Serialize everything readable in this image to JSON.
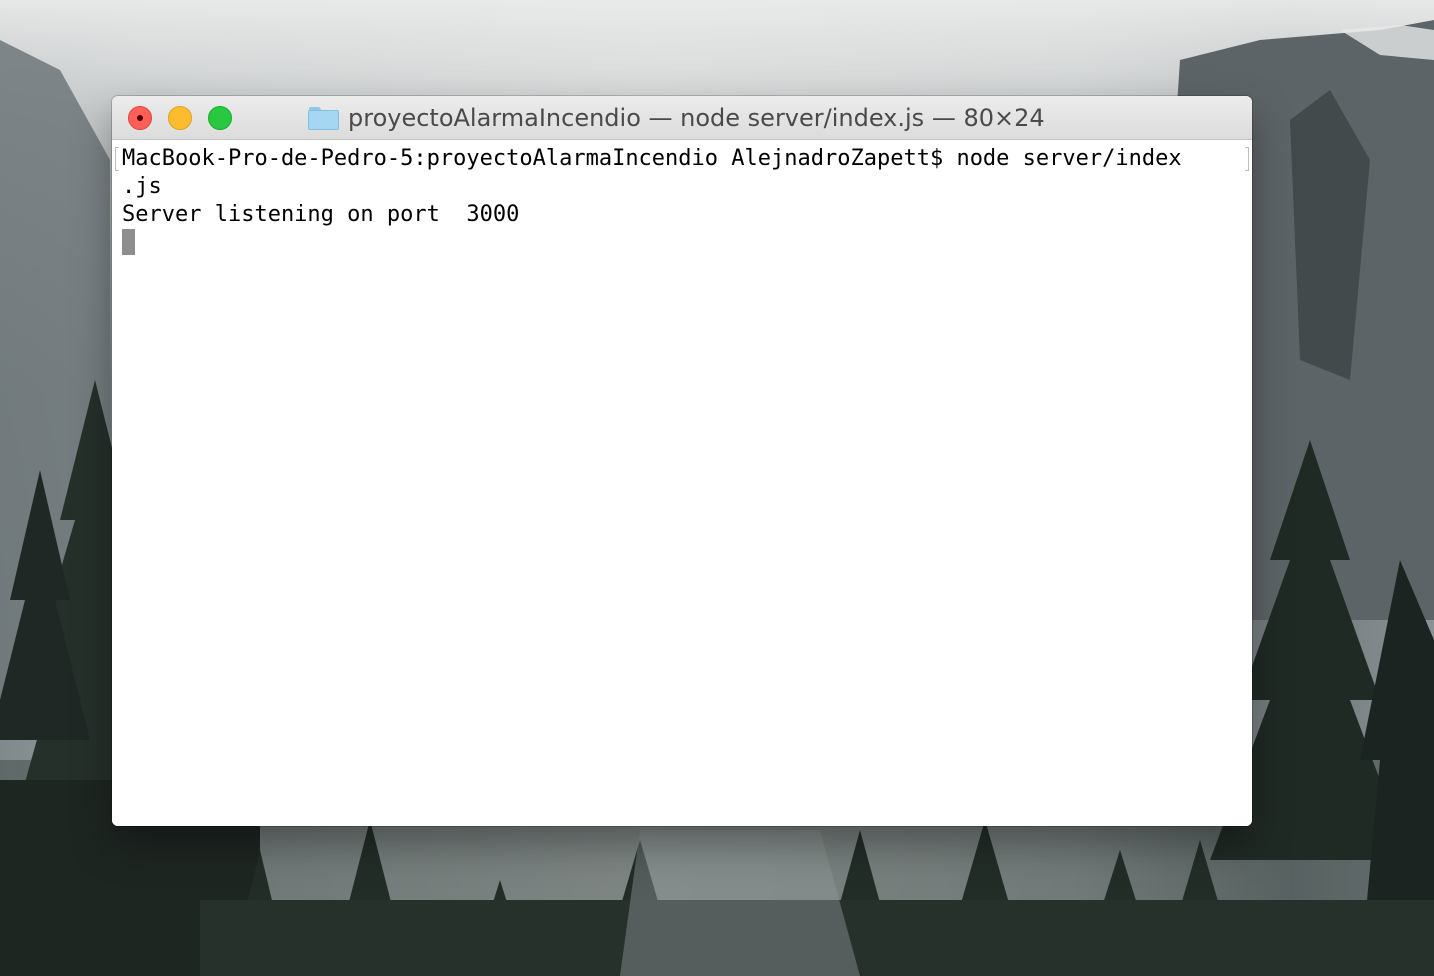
{
  "window": {
    "title": "proyectoAlarmaIncendio — node server/index.js — 80×24",
    "title_icon": "folder-icon",
    "buttons": {
      "close": "close-button",
      "minimize": "minimize-button",
      "zoom": "zoom-button"
    }
  },
  "terminal": {
    "lines": [
      "MacBook-Pro-de-Pedro-5:proyectoAlarmaIncendio AlejnadroZapett$ node server/index",
      ".js",
      "Server listening on port  3000"
    ],
    "cursor": "block-cursor"
  },
  "colors": {
    "close": "#fc5f57",
    "minimize": "#fdbc2e",
    "zoom": "#28c840",
    "folder": "#a6d7f2"
  }
}
